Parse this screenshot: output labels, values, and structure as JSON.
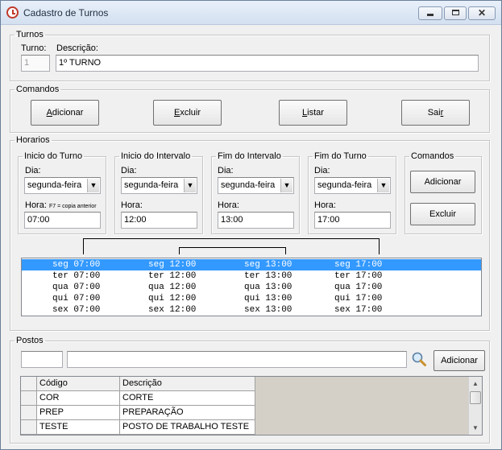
{
  "window": {
    "title": "Cadastro de Turnos"
  },
  "turnos": {
    "legend": "Turnos",
    "turno_label": "Turno:",
    "turno_value": "1",
    "descricao_label": "Descrição:",
    "descricao_value": "1º TURNO"
  },
  "comandos": {
    "legend": "Comandos",
    "adicionar": {
      "key": "A",
      "rest": "dicionar"
    },
    "excluir": {
      "key": "E",
      "rest": "xcluir"
    },
    "listar": {
      "key": "L",
      "rest": "istar"
    },
    "sair": {
      "pre": "Sai",
      "key": "r"
    }
  },
  "horarios": {
    "legend": "Horarios",
    "inicio_turno": {
      "legend": "Inicio do Turno",
      "dia_label": "Dia:",
      "dia_value": "segunda-feira",
      "hora_label": "Hora:",
      "hint": "F7 = copia anterior",
      "hora_value": "07:00"
    },
    "inicio_intervalo": {
      "legend": "Inicio do Intervalo",
      "dia_label": "Dia:",
      "dia_value": "segunda-feira",
      "hora_label": "Hora:",
      "hora_value": "12:00"
    },
    "fim_intervalo": {
      "legend": "Fim do Intervalo",
      "dia_label": "Dia:",
      "dia_value": "segunda-feira",
      "hora_label": "Hora:",
      "hora_value": "13:00"
    },
    "fim_turno": {
      "legend": "Fim do Turno",
      "dia_label": "Dia:",
      "dia_value": "segunda-feira",
      "hora_label": "Hora:",
      "hora_value": "17:00"
    },
    "comandos": {
      "legend": "Comandos",
      "adicionar": "Adicionar",
      "excluir": "Excluir"
    },
    "schedule": [
      [
        "seg 07:00",
        "seg 12:00",
        "seg 13:00",
        "seg 17:00"
      ],
      [
        "ter 07:00",
        "ter 12:00",
        "ter 13:00",
        "ter 17:00"
      ],
      [
        "qua 07:00",
        "qua 12:00",
        "qua 13:00",
        "qua 17:00"
      ],
      [
        "qui 07:00",
        "qui 12:00",
        "qui 13:00",
        "qui 17:00"
      ],
      [
        "sex 07:00",
        "sex 12:00",
        "sex 13:00",
        "sex 17:00"
      ]
    ]
  },
  "postos": {
    "legend": "Postos",
    "codigo_value": "",
    "descricao_value": "",
    "adicionar": "Adicionar",
    "columns": [
      "Código",
      "Descrição"
    ],
    "rows": [
      [
        "COR",
        "CORTE"
      ],
      [
        "PREP",
        "PREPARAÇÃO"
      ],
      [
        "TESTE",
        "POSTO DE TRABALHO TESTE"
      ]
    ]
  },
  "colors": {
    "selection": "#3399ff",
    "window_bg": "#f0f0f0"
  },
  "icons": {
    "app": "alarm-clock-icon",
    "search": "search-icon"
  }
}
